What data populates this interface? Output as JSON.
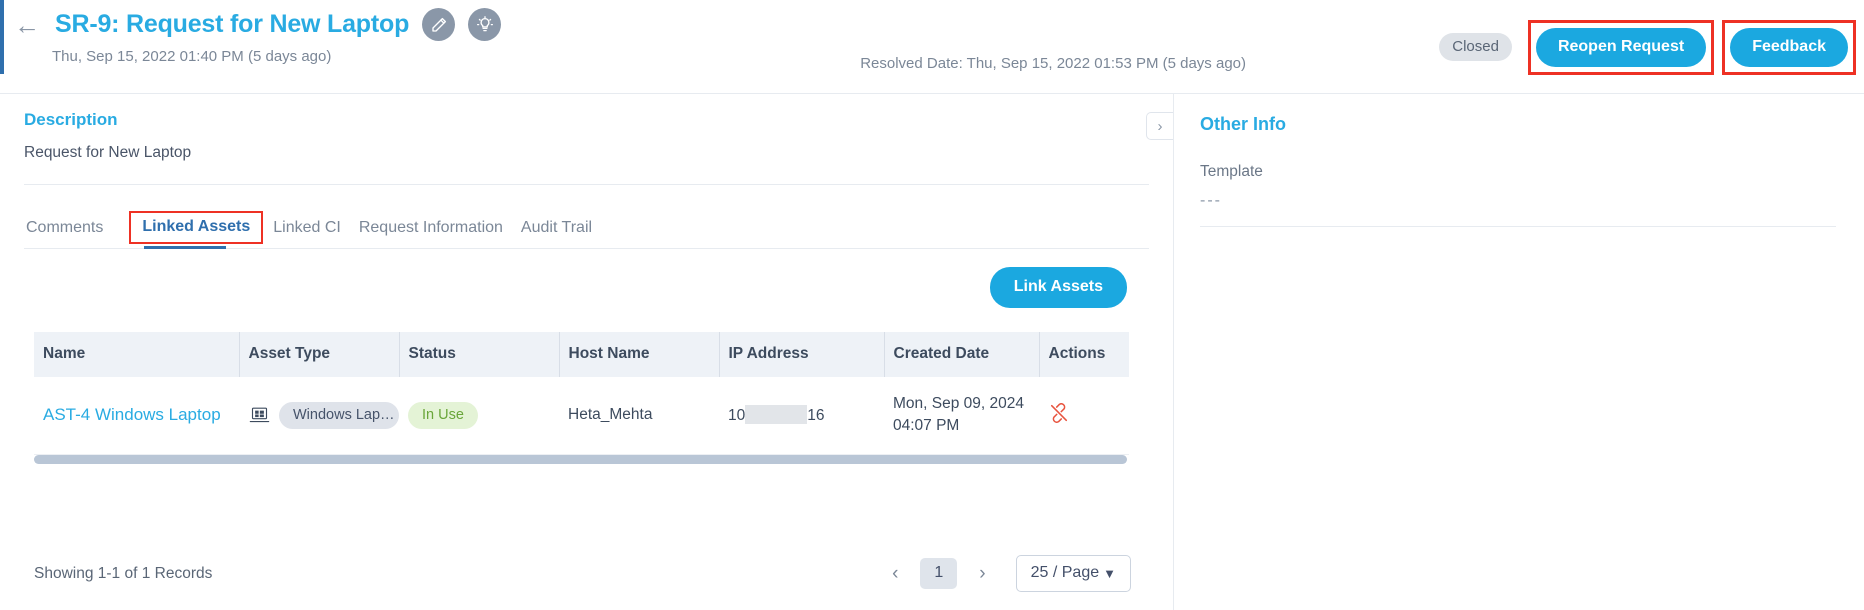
{
  "header": {
    "back_icon": "back-arrow-icon",
    "title": "SR-9: Request for New Laptop",
    "edit_icon": "pencil-icon",
    "insight_icon": "lightbulb-icon",
    "subtitle": "Thu, Sep 15, 2022 01:40 PM (5 days ago)",
    "status": "Closed",
    "reopen_label": "Reopen Request",
    "feedback_label": "Feedback",
    "resolved_date": "Resolved Date: Thu, Sep 15, 2022 01:53 PM (5 days ago)"
  },
  "description": {
    "heading": "Description",
    "text": "Request for New Laptop"
  },
  "collapse": {
    "icon": "chevron-right-icon"
  },
  "tabs": [
    {
      "label": "Comments",
      "active": false
    },
    {
      "label": "Linked Assets",
      "active": true
    },
    {
      "label": "Linked CI",
      "active": false
    },
    {
      "label": "Request Information",
      "active": false
    },
    {
      "label": "Audit Trail",
      "active": false
    }
  ],
  "actions": {
    "link_assets_label": "Link Assets"
  },
  "table": {
    "columns": [
      "Name",
      "Asset Type",
      "Status",
      "Host Name",
      "IP Address",
      "Created Date",
      "Actions"
    ],
    "rows": [
      {
        "name": "AST-4 Windows Laptop",
        "asset_type_icon": "windows-laptop-icon",
        "asset_type": "Windows Lap…",
        "status": "In Use",
        "host_name": "Heta_Mehta",
        "ip_prefix": "10",
        "ip_suffix": "16",
        "created_date_line1": "Mon, Sep 09, 2024",
        "created_date_line2": "04:07 PM",
        "action_icon": "unlink-icon"
      }
    ]
  },
  "footer": {
    "showing": "Showing 1-1 of 1 Records",
    "prev_icon": "chevron-left-icon",
    "next_icon": "chevron-right-icon",
    "current_page": "1",
    "page_size": "25 / Page",
    "caret_icon": "chevron-down-icon"
  },
  "side": {
    "title": "Other Info",
    "template_label": "Template",
    "template_value": "---"
  },
  "colors": {
    "accent_blue": "#29abe2",
    "button_blue": "#1ba8e0",
    "highlight_red": "#ee3124",
    "tab_active": "#2f6fad",
    "status_green": "#6aa63a"
  }
}
